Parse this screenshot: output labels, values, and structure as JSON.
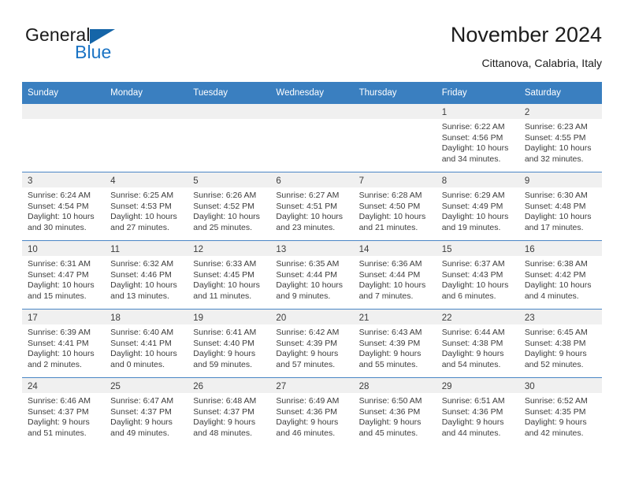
{
  "brand": {
    "line1": "General",
    "line2": "Blue",
    "accent_color": "#1a73c4",
    "triangle_color": "#1565a8"
  },
  "header": {
    "title": "November 2024",
    "subtitle": "Cittanova, Calabria, Italy"
  },
  "calendar": {
    "header_bg": "#3a7fc0",
    "daynum_bg": "#f0f0f0",
    "weekday_headers": [
      "Sunday",
      "Monday",
      "Tuesday",
      "Wednesday",
      "Thursday",
      "Friday",
      "Saturday"
    ],
    "weeks": [
      [
        {
          "day": "",
          "empty": true
        },
        {
          "day": "",
          "empty": true
        },
        {
          "day": "",
          "empty": true
        },
        {
          "day": "",
          "empty": true
        },
        {
          "day": "",
          "empty": true
        },
        {
          "day": "1",
          "sunrise": "Sunrise: 6:22 AM",
          "sunset": "Sunset: 4:56 PM",
          "daylight": "Daylight: 10 hours and 34 minutes."
        },
        {
          "day": "2",
          "sunrise": "Sunrise: 6:23 AM",
          "sunset": "Sunset: 4:55 PM",
          "daylight": "Daylight: 10 hours and 32 minutes."
        }
      ],
      [
        {
          "day": "3",
          "sunrise": "Sunrise: 6:24 AM",
          "sunset": "Sunset: 4:54 PM",
          "daylight": "Daylight: 10 hours and 30 minutes."
        },
        {
          "day": "4",
          "sunrise": "Sunrise: 6:25 AM",
          "sunset": "Sunset: 4:53 PM",
          "daylight": "Daylight: 10 hours and 27 minutes."
        },
        {
          "day": "5",
          "sunrise": "Sunrise: 6:26 AM",
          "sunset": "Sunset: 4:52 PM",
          "daylight": "Daylight: 10 hours and 25 minutes."
        },
        {
          "day": "6",
          "sunrise": "Sunrise: 6:27 AM",
          "sunset": "Sunset: 4:51 PM",
          "daylight": "Daylight: 10 hours and 23 minutes."
        },
        {
          "day": "7",
          "sunrise": "Sunrise: 6:28 AM",
          "sunset": "Sunset: 4:50 PM",
          "daylight": "Daylight: 10 hours and 21 minutes."
        },
        {
          "day": "8",
          "sunrise": "Sunrise: 6:29 AM",
          "sunset": "Sunset: 4:49 PM",
          "daylight": "Daylight: 10 hours and 19 minutes."
        },
        {
          "day": "9",
          "sunrise": "Sunrise: 6:30 AM",
          "sunset": "Sunset: 4:48 PM",
          "daylight": "Daylight: 10 hours and 17 minutes."
        }
      ],
      [
        {
          "day": "10",
          "sunrise": "Sunrise: 6:31 AM",
          "sunset": "Sunset: 4:47 PM",
          "daylight": "Daylight: 10 hours and 15 minutes."
        },
        {
          "day": "11",
          "sunrise": "Sunrise: 6:32 AM",
          "sunset": "Sunset: 4:46 PM",
          "daylight": "Daylight: 10 hours and 13 minutes."
        },
        {
          "day": "12",
          "sunrise": "Sunrise: 6:33 AM",
          "sunset": "Sunset: 4:45 PM",
          "daylight": "Daylight: 10 hours and 11 minutes."
        },
        {
          "day": "13",
          "sunrise": "Sunrise: 6:35 AM",
          "sunset": "Sunset: 4:44 PM",
          "daylight": "Daylight: 10 hours and 9 minutes."
        },
        {
          "day": "14",
          "sunrise": "Sunrise: 6:36 AM",
          "sunset": "Sunset: 4:44 PM",
          "daylight": "Daylight: 10 hours and 7 minutes."
        },
        {
          "day": "15",
          "sunrise": "Sunrise: 6:37 AM",
          "sunset": "Sunset: 4:43 PM",
          "daylight": "Daylight: 10 hours and 6 minutes."
        },
        {
          "day": "16",
          "sunrise": "Sunrise: 6:38 AM",
          "sunset": "Sunset: 4:42 PM",
          "daylight": "Daylight: 10 hours and 4 minutes."
        }
      ],
      [
        {
          "day": "17",
          "sunrise": "Sunrise: 6:39 AM",
          "sunset": "Sunset: 4:41 PM",
          "daylight": "Daylight: 10 hours and 2 minutes."
        },
        {
          "day": "18",
          "sunrise": "Sunrise: 6:40 AM",
          "sunset": "Sunset: 4:41 PM",
          "daylight": "Daylight: 10 hours and 0 minutes."
        },
        {
          "day": "19",
          "sunrise": "Sunrise: 6:41 AM",
          "sunset": "Sunset: 4:40 PM",
          "daylight": "Daylight: 9 hours and 59 minutes."
        },
        {
          "day": "20",
          "sunrise": "Sunrise: 6:42 AM",
          "sunset": "Sunset: 4:39 PM",
          "daylight": "Daylight: 9 hours and 57 minutes."
        },
        {
          "day": "21",
          "sunrise": "Sunrise: 6:43 AM",
          "sunset": "Sunset: 4:39 PM",
          "daylight": "Daylight: 9 hours and 55 minutes."
        },
        {
          "day": "22",
          "sunrise": "Sunrise: 6:44 AM",
          "sunset": "Sunset: 4:38 PM",
          "daylight": "Daylight: 9 hours and 54 minutes."
        },
        {
          "day": "23",
          "sunrise": "Sunrise: 6:45 AM",
          "sunset": "Sunset: 4:38 PM",
          "daylight": "Daylight: 9 hours and 52 minutes."
        }
      ],
      [
        {
          "day": "24",
          "sunrise": "Sunrise: 6:46 AM",
          "sunset": "Sunset: 4:37 PM",
          "daylight": "Daylight: 9 hours and 51 minutes."
        },
        {
          "day": "25",
          "sunrise": "Sunrise: 6:47 AM",
          "sunset": "Sunset: 4:37 PM",
          "daylight": "Daylight: 9 hours and 49 minutes."
        },
        {
          "day": "26",
          "sunrise": "Sunrise: 6:48 AM",
          "sunset": "Sunset: 4:37 PM",
          "daylight": "Daylight: 9 hours and 48 minutes."
        },
        {
          "day": "27",
          "sunrise": "Sunrise: 6:49 AM",
          "sunset": "Sunset: 4:36 PM",
          "daylight": "Daylight: 9 hours and 46 minutes."
        },
        {
          "day": "28",
          "sunrise": "Sunrise: 6:50 AM",
          "sunset": "Sunset: 4:36 PM",
          "daylight": "Daylight: 9 hours and 45 minutes."
        },
        {
          "day": "29",
          "sunrise": "Sunrise: 6:51 AM",
          "sunset": "Sunset: 4:36 PM",
          "daylight": "Daylight: 9 hours and 44 minutes."
        },
        {
          "day": "30",
          "sunrise": "Sunrise: 6:52 AM",
          "sunset": "Sunset: 4:35 PM",
          "daylight": "Daylight: 9 hours and 42 minutes."
        }
      ]
    ]
  }
}
